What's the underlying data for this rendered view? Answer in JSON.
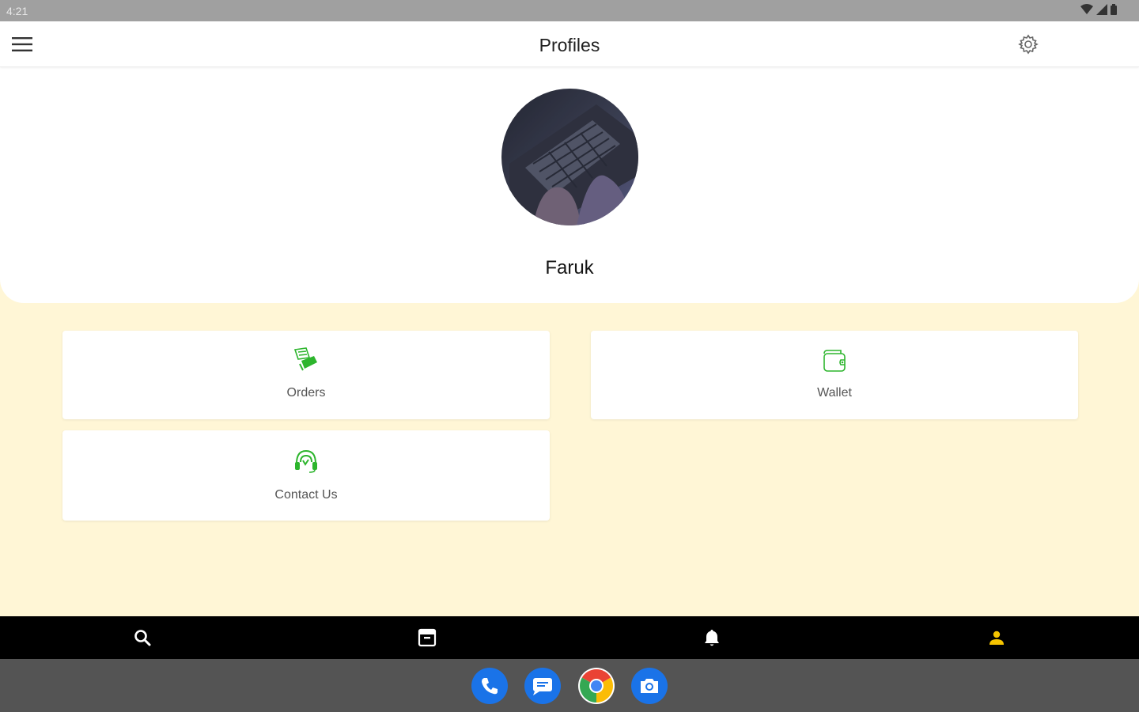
{
  "status_bar": {
    "time": "4:21"
  },
  "app_bar": {
    "title": "Profiles"
  },
  "profile": {
    "name": "Faruk"
  },
  "tiles": [
    {
      "label": "Orders",
      "icon": "orders-icon"
    },
    {
      "label": "Wallet",
      "icon": "wallet-icon"
    },
    {
      "label": "Contact Us",
      "icon": "support-headset-icon"
    }
  ],
  "bottom_nav": [
    {
      "icon": "search-icon"
    },
    {
      "icon": "archive-icon"
    },
    {
      "icon": "bell-icon"
    },
    {
      "icon": "person-icon",
      "active": true
    }
  ],
  "dock": [
    {
      "icon": "phone-icon"
    },
    {
      "icon": "messages-icon"
    },
    {
      "icon": "chrome-icon"
    },
    {
      "icon": "camera-icon"
    }
  ],
  "colors": {
    "accent_green": "#2DB52D",
    "page_background": "#FFF6D6",
    "nav_active": "#F5C400",
    "nav_inactive": "#FFFFFF",
    "dock_blue": "#1A73E8"
  }
}
